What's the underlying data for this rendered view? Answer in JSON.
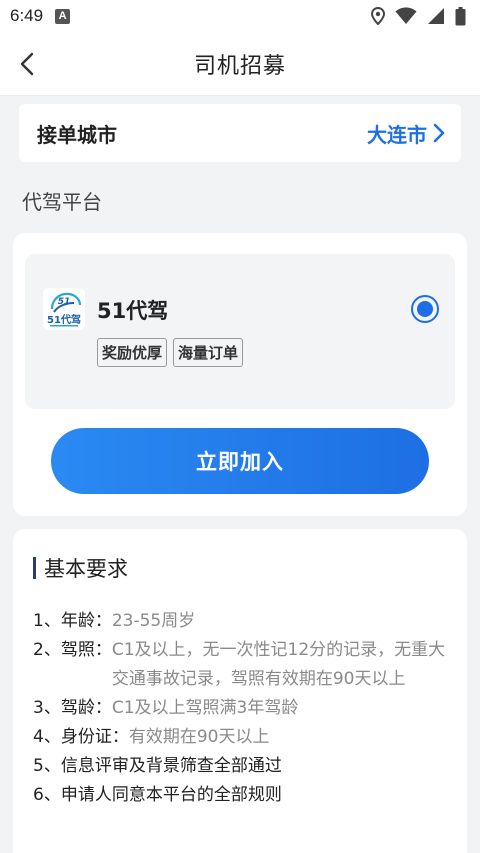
{
  "status_bar": {
    "time": "6:49",
    "notification_icon": "A",
    "icons": [
      "location-icon",
      "wifi-icon",
      "signal-icon",
      "battery-icon"
    ]
  },
  "nav": {
    "title": "司机招募",
    "back_icon": "chevron-left-icon"
  },
  "city": {
    "label": "接单城市",
    "value": "大连市"
  },
  "platform_section": {
    "title": "代驾平台",
    "items": [
      {
        "name": "51代驾",
        "logo_text": "51代驾",
        "tags": [
          "奖励优厚",
          "海量订单"
        ],
        "selected": true
      }
    ],
    "join_label": "立即加入"
  },
  "requirements": {
    "title": "基本要求",
    "rows": [
      {
        "key": "1、年龄：",
        "value": "23-55周岁"
      },
      {
        "key": "2、驾照：",
        "value": "C1及以上，无一次性记12分的记录，无重大交通事故记录，驾照有效期在90天以上"
      },
      {
        "key": "3、驾龄：",
        "value": "C1及以上驾照满3年驾龄"
      },
      {
        "key": "4、身份证：",
        "value": "有效期在90天以上"
      },
      {
        "key": "5、信息评审及背景筛查全部通过",
        "value": ""
      },
      {
        "key": "6、申请人同意本平台的全部规则",
        "value": ""
      }
    ]
  },
  "colors": {
    "accent": "#1e6fe6",
    "background": "#f2f3f5"
  }
}
